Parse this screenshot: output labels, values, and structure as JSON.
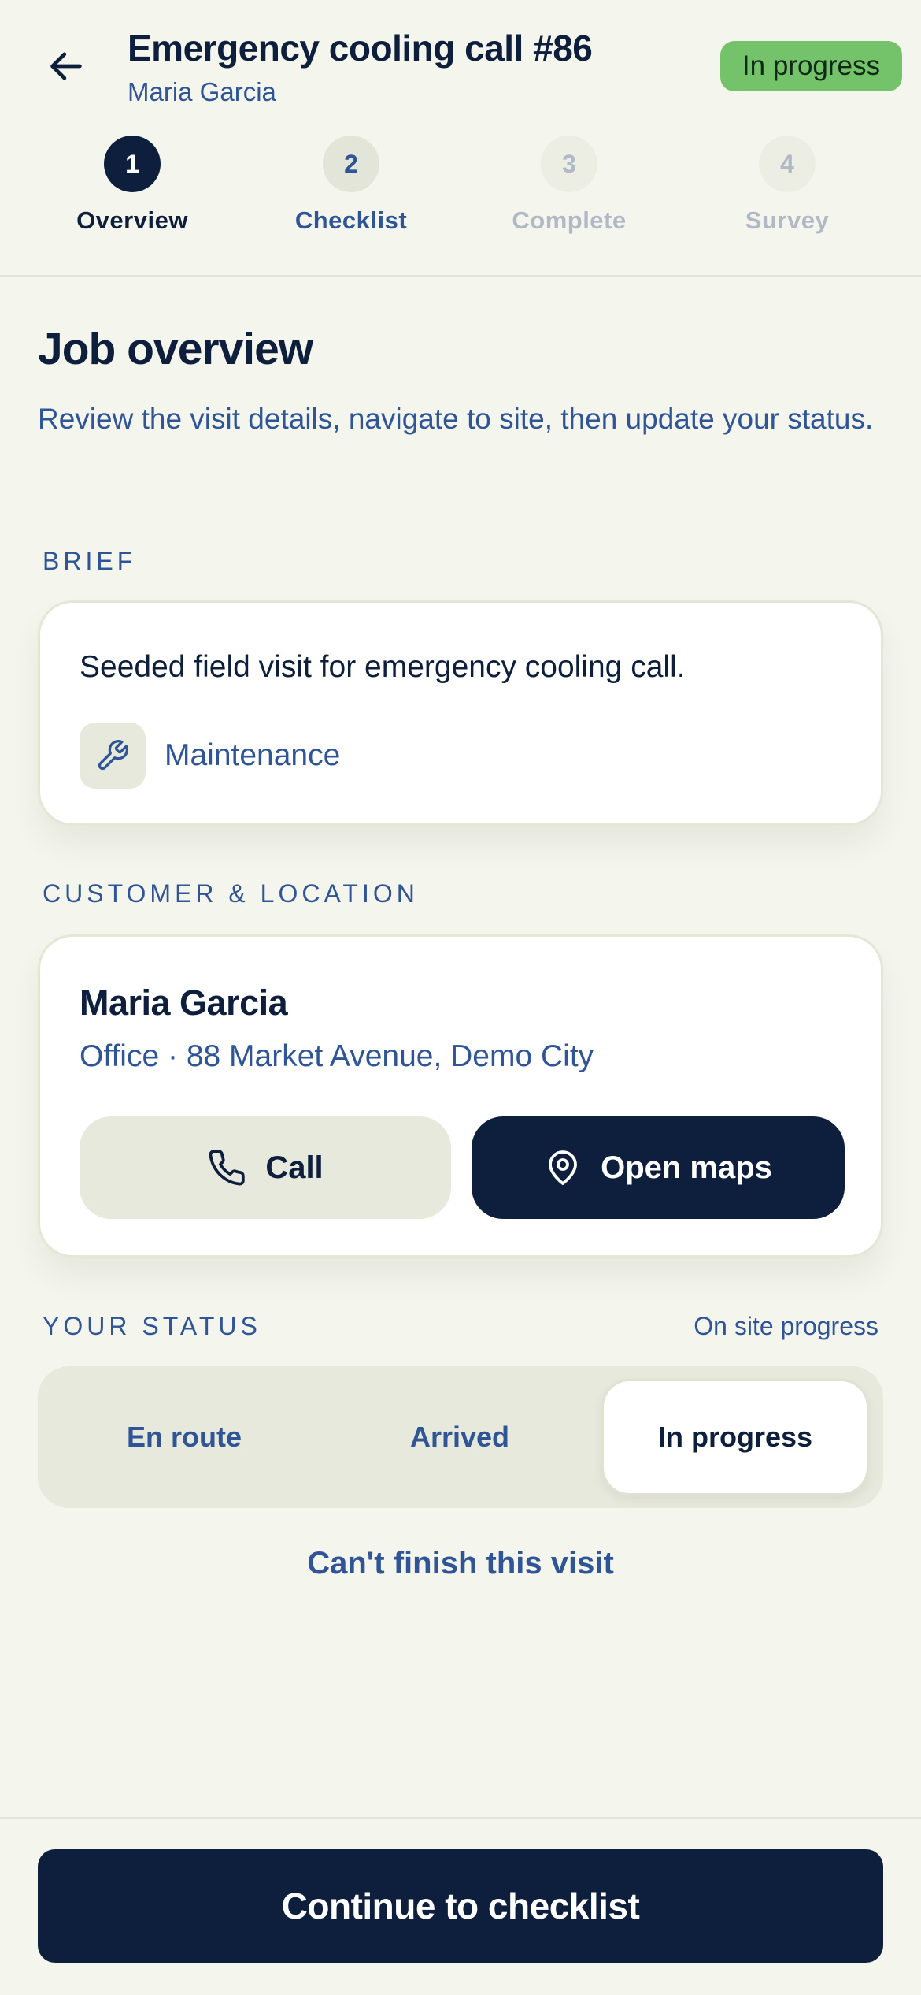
{
  "header": {
    "title": "Emergency cooling call #86",
    "subtitle": "Maria Garcia",
    "status_badge": "In progress",
    "back_icon": "arrow-left-icon"
  },
  "steps": [
    {
      "number": "1",
      "label": "Overview",
      "state": "active"
    },
    {
      "number": "2",
      "label": "Checklist",
      "state": "next"
    },
    {
      "number": "3",
      "label": "Complete",
      "state": "future"
    },
    {
      "number": "4",
      "label": "Survey",
      "state": "future"
    }
  ],
  "main": {
    "title": "Job overview",
    "description": "Review the visit details, navigate to site, then update your status."
  },
  "brief": {
    "section_label": "BRIEF",
    "text": "Seeded field visit for emergency cooling call.",
    "tag_icon": "wrench-icon",
    "tag_label": "Maintenance"
  },
  "customer": {
    "section_label": "CUSTOMER & LOCATION",
    "name": "Maria Garcia",
    "address": "Office · 88 Market Avenue, Demo City",
    "call_label": "Call",
    "call_icon": "phone-icon",
    "maps_label": "Open maps",
    "maps_icon": "map-pin-icon"
  },
  "status": {
    "section_label": "YOUR STATUS",
    "section_right": "On site progress",
    "options": [
      "En route",
      "Arrived",
      "In progress"
    ],
    "selected": "In progress"
  },
  "cant_finish_label": "Can't finish this visit",
  "footer": {
    "primary_label": "Continue to checklist"
  },
  "colors": {
    "navy": "#0d1f3c",
    "blue_text": "#2f5597",
    "badge_green": "#74c26a",
    "background": "#f4f5ec"
  }
}
